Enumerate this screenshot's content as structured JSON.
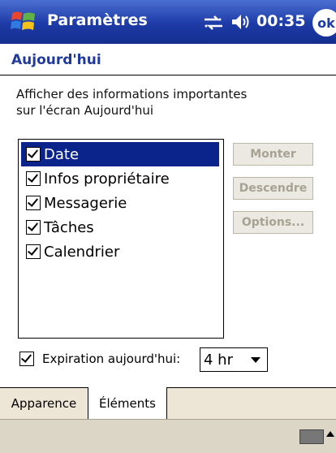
{
  "titlebar": {
    "app_title": "Paramètres",
    "clock": "00:35",
    "ok_label": "ok"
  },
  "page": {
    "title": "Aujourd'hui",
    "description_line1": "Afficher des informations importantes",
    "description_line2": "sur l'écran Aujourd'hui"
  },
  "items": [
    {
      "label": "Date",
      "checked": true,
      "selected": true
    },
    {
      "label": "Infos propriétaire",
      "checked": true,
      "selected": false
    },
    {
      "label": "Messagerie",
      "checked": true,
      "selected": false
    },
    {
      "label": "Tâches",
      "checked": true,
      "selected": false
    },
    {
      "label": "Calendrier",
      "checked": true,
      "selected": false
    }
  ],
  "buttons": {
    "up": "Monter",
    "down": "Descendre",
    "options": "Options..."
  },
  "expiration": {
    "label": "Expiration aujourd'hui:",
    "checked": true,
    "value": "4 hr"
  },
  "tabs": {
    "appearance": "Apparence",
    "elements": "Éléments",
    "active": "Éléments"
  },
  "colors": {
    "titlebar": "#1d3aa6",
    "selection": "#0b248c",
    "disabled_text": "#a8a293"
  }
}
